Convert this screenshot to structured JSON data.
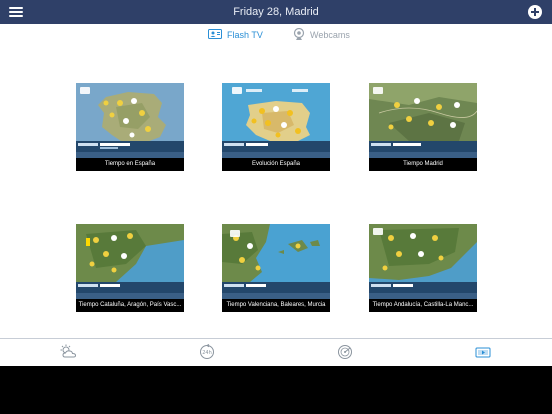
{
  "header": {
    "title": "Friday 28, Madrid",
    "menu_icon": "hamburger-menu-icon",
    "add_icon": "plus-circle-icon"
  },
  "tabs": [
    {
      "label": "Flash TV",
      "icon": "tv-icon",
      "active": true
    },
    {
      "label": "Webcams",
      "icon": "webcam-icon",
      "active": false
    }
  ],
  "videos": [
    {
      "caption": "Tiempo en España"
    },
    {
      "caption": "Evolución España"
    },
    {
      "caption": "Tiempo Madrid"
    },
    {
      "caption": "Tiempo Cataluña, Aragón, País Vasc..."
    },
    {
      "caption": "Tiempo Valenciana, Baleares, Murcia"
    },
    {
      "caption": "Tiempo Andalucía, Castilla-La Manc..."
    }
  ],
  "bottom_nav": [
    {
      "name": "forecast-tab",
      "icon": "cloud-sun-icon",
      "active": false
    },
    {
      "name": "24h-tab",
      "icon": "24h-icon",
      "active": false
    },
    {
      "name": "radar-tab",
      "icon": "radar-icon",
      "active": false
    },
    {
      "name": "video-tab",
      "icon": "video-icon",
      "active": true
    }
  ],
  "colors": {
    "header_bg": "#2f4068",
    "accent": "#2a8fd6",
    "inactive": "#9aa3ad"
  }
}
